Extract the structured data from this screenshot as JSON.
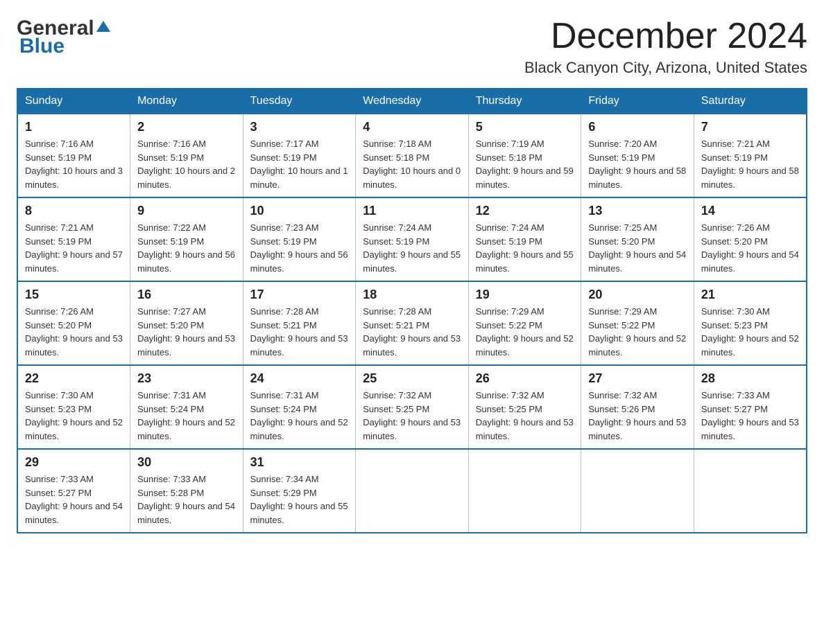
{
  "header": {
    "logo_general": "General",
    "logo_blue": "Blue",
    "month_title": "December 2024",
    "location": "Black Canyon City, Arizona, United States"
  },
  "weekdays": [
    "Sunday",
    "Monday",
    "Tuesday",
    "Wednesday",
    "Thursday",
    "Friday",
    "Saturday"
  ],
  "weeks": [
    [
      {
        "day": "1",
        "sunrise": "7:16 AM",
        "sunset": "5:19 PM",
        "daylight": "10 hours and 3 minutes."
      },
      {
        "day": "2",
        "sunrise": "7:16 AM",
        "sunset": "5:19 PM",
        "daylight": "10 hours and 2 minutes."
      },
      {
        "day": "3",
        "sunrise": "7:17 AM",
        "sunset": "5:19 PM",
        "daylight": "10 hours and 1 minute."
      },
      {
        "day": "4",
        "sunrise": "7:18 AM",
        "sunset": "5:18 PM",
        "daylight": "10 hours and 0 minutes."
      },
      {
        "day": "5",
        "sunrise": "7:19 AM",
        "sunset": "5:18 PM",
        "daylight": "9 hours and 59 minutes."
      },
      {
        "day": "6",
        "sunrise": "7:20 AM",
        "sunset": "5:19 PM",
        "daylight": "9 hours and 58 minutes."
      },
      {
        "day": "7",
        "sunrise": "7:21 AM",
        "sunset": "5:19 PM",
        "daylight": "9 hours and 58 minutes."
      }
    ],
    [
      {
        "day": "8",
        "sunrise": "7:21 AM",
        "sunset": "5:19 PM",
        "daylight": "9 hours and 57 minutes."
      },
      {
        "day": "9",
        "sunrise": "7:22 AM",
        "sunset": "5:19 PM",
        "daylight": "9 hours and 56 minutes."
      },
      {
        "day": "10",
        "sunrise": "7:23 AM",
        "sunset": "5:19 PM",
        "daylight": "9 hours and 56 minutes."
      },
      {
        "day": "11",
        "sunrise": "7:24 AM",
        "sunset": "5:19 PM",
        "daylight": "9 hours and 55 minutes."
      },
      {
        "day": "12",
        "sunrise": "7:24 AM",
        "sunset": "5:19 PM",
        "daylight": "9 hours and 55 minutes."
      },
      {
        "day": "13",
        "sunrise": "7:25 AM",
        "sunset": "5:20 PM",
        "daylight": "9 hours and 54 minutes."
      },
      {
        "day": "14",
        "sunrise": "7:26 AM",
        "sunset": "5:20 PM",
        "daylight": "9 hours and 54 minutes."
      }
    ],
    [
      {
        "day": "15",
        "sunrise": "7:26 AM",
        "sunset": "5:20 PM",
        "daylight": "9 hours and 53 minutes."
      },
      {
        "day": "16",
        "sunrise": "7:27 AM",
        "sunset": "5:20 PM",
        "daylight": "9 hours and 53 minutes."
      },
      {
        "day": "17",
        "sunrise": "7:28 AM",
        "sunset": "5:21 PM",
        "daylight": "9 hours and 53 minutes."
      },
      {
        "day": "18",
        "sunrise": "7:28 AM",
        "sunset": "5:21 PM",
        "daylight": "9 hours and 53 minutes."
      },
      {
        "day": "19",
        "sunrise": "7:29 AM",
        "sunset": "5:22 PM",
        "daylight": "9 hours and 52 minutes."
      },
      {
        "day": "20",
        "sunrise": "7:29 AM",
        "sunset": "5:22 PM",
        "daylight": "9 hours and 52 minutes."
      },
      {
        "day": "21",
        "sunrise": "7:30 AM",
        "sunset": "5:23 PM",
        "daylight": "9 hours and 52 minutes."
      }
    ],
    [
      {
        "day": "22",
        "sunrise": "7:30 AM",
        "sunset": "5:23 PM",
        "daylight": "9 hours and 52 minutes."
      },
      {
        "day": "23",
        "sunrise": "7:31 AM",
        "sunset": "5:24 PM",
        "daylight": "9 hours and 52 minutes."
      },
      {
        "day": "24",
        "sunrise": "7:31 AM",
        "sunset": "5:24 PM",
        "daylight": "9 hours and 52 minutes."
      },
      {
        "day": "25",
        "sunrise": "7:32 AM",
        "sunset": "5:25 PM",
        "daylight": "9 hours and 53 minutes."
      },
      {
        "day": "26",
        "sunrise": "7:32 AM",
        "sunset": "5:25 PM",
        "daylight": "9 hours and 53 minutes."
      },
      {
        "day": "27",
        "sunrise": "7:32 AM",
        "sunset": "5:26 PM",
        "daylight": "9 hours and 53 minutes."
      },
      {
        "day": "28",
        "sunrise": "7:33 AM",
        "sunset": "5:27 PM",
        "daylight": "9 hours and 53 minutes."
      }
    ],
    [
      {
        "day": "29",
        "sunrise": "7:33 AM",
        "sunset": "5:27 PM",
        "daylight": "9 hours and 54 minutes."
      },
      {
        "day": "30",
        "sunrise": "7:33 AM",
        "sunset": "5:28 PM",
        "daylight": "9 hours and 54 minutes."
      },
      {
        "day": "31",
        "sunrise": "7:34 AM",
        "sunset": "5:29 PM",
        "daylight": "9 hours and 55 minutes."
      },
      null,
      null,
      null,
      null
    ]
  ],
  "labels": {
    "sunrise": "Sunrise:",
    "sunset": "Sunset:",
    "daylight": "Daylight:"
  }
}
